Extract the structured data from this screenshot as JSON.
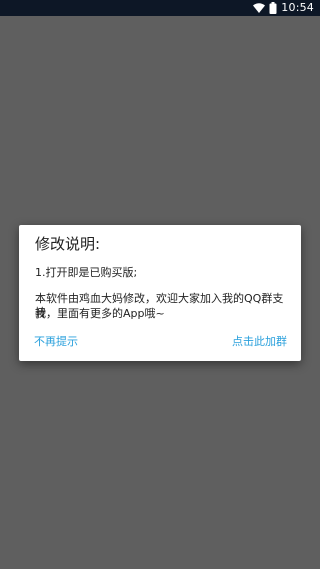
{
  "status_bar": {
    "time": "10:54",
    "icons": [
      "wifi-icon",
      "battery-icon"
    ]
  },
  "dialog": {
    "title": "修改说明:",
    "message_lines": [
      "1.打开即是已购买版;",
      "本软件由鸡血大妈修改，欢迎大家加入我的QQ群支持",
      "我，里面有更多的App哦~"
    ],
    "actions": {
      "dismiss": "不再提示",
      "join_group": "点击此加群"
    }
  },
  "colors": {
    "status_bar": "#0d1726",
    "scrim": "#5f5f5f",
    "dialog_bg": "#ffffff",
    "action_text": "#29a0dc"
  }
}
